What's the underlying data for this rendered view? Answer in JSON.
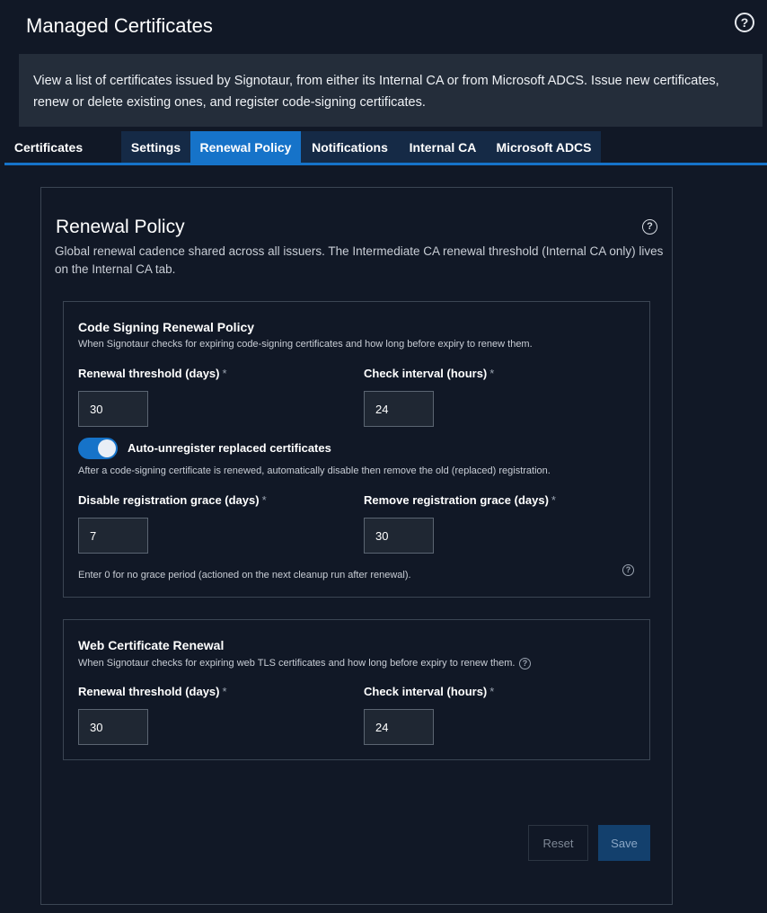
{
  "header": {
    "title": "Managed Certificates",
    "help_icon": "question-circle-icon",
    "help_glyph": "?"
  },
  "intro": {
    "text": "View a list of certificates issued by Signotaur, from either its Internal CA or from Microsoft ADCS. Issue new certificates, renew or delete existing ones, and register code-signing certificates."
  },
  "tabs": [
    {
      "label": "Certificates"
    },
    {
      "label": "Settings"
    },
    {
      "label": "Renewal Policy",
      "active": true
    },
    {
      "label": "Notifications"
    },
    {
      "label": "Internal CA"
    },
    {
      "label": "Microsoft ADCS"
    }
  ],
  "card": {
    "title": "Renewal Policy",
    "help_glyph": "?",
    "description": "Global renewal cadence shared across all issuers. The Intermediate CA renewal threshold (Internal CA only) lives on the Internal CA tab."
  },
  "code_signing": {
    "title": "Code Signing Renewal Policy",
    "description": "When Signotaur checks for expiring code-signing certificates and how long before expiry to renew them.",
    "renewal_threshold_label": "Renewal threshold (days)",
    "renewal_threshold_value": "30",
    "check_interval_label": "Check interval (hours)",
    "check_interval_value": "24",
    "required_marker": "*",
    "auto_unregister_label": "Auto-unregister replaced certificates",
    "auto_unregister_enabled": true,
    "auto_unregister_description": "After a code-signing certificate is renewed, automatically disable then remove the old (replaced) registration.",
    "disable_grace_label": "Disable registration grace (days)",
    "disable_grace_value": "7",
    "remove_grace_label": "Remove registration grace (days)",
    "remove_grace_value": "30",
    "grace_note": "Enter 0 for no grace period (actioned on the next cleanup run after renewal).",
    "help_glyph": "?"
  },
  "web": {
    "title": "Web Certificate Renewal",
    "description": "When Signotaur checks for expiring web TLS certificates and how long before expiry to renew them.",
    "renewal_threshold_label": "Renewal threshold (days)",
    "renewal_threshold_value": "30",
    "check_interval_label": "Check interval (hours)",
    "check_interval_value": "24",
    "required_marker": "*",
    "help_glyph": "?"
  },
  "actions": {
    "reset_label": "Reset",
    "save_label": "Save"
  },
  "colors": {
    "background": "#111826",
    "accent": "#1673c9",
    "panel": "#242d3a"
  }
}
